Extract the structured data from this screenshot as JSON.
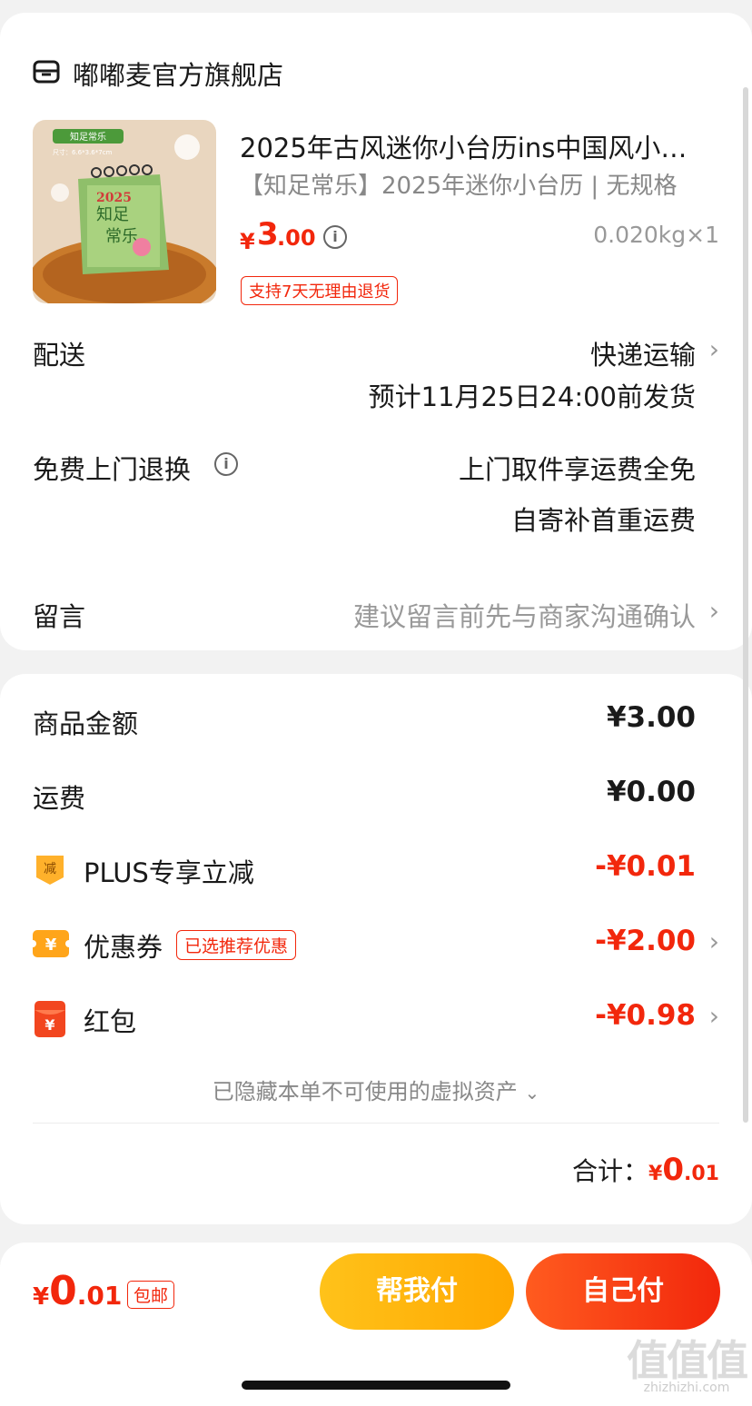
{
  "store": {
    "name": "嘟嘟麦官方旗舰店",
    "icon": "store-icon"
  },
  "product": {
    "title": "2025年古风迷你小台历ins中国风小…",
    "spec": "【知足常乐】2025年迷你小台历 | 无规格",
    "price_symbol": "¥",
    "price_int": "3",
    "price_dec": ".00",
    "weight": "0.020kg×1",
    "return_badge": "支持7天无理由退货",
    "thumb_label": "知足常乐",
    "thumb_size": "尺寸：6.6*3.6*7cm",
    "thumb_year": "2025"
  },
  "delivery": {
    "label": "配送",
    "method": "快递运输",
    "eta": "预计11月25日24:00前发货"
  },
  "exchange": {
    "label": "免费上门退换",
    "line1": "上门取件享运费全免",
    "line2": "自寄补首重运费"
  },
  "message": {
    "label": "留言",
    "placeholder": "建议留言前先与商家沟通确认"
  },
  "summary": {
    "goods_label": "商品金额",
    "goods_amount": "¥3.00",
    "freight_label": "运费",
    "freight_amount": "¥0.00",
    "plus_label": "PLUS专享立减",
    "plus_amount": "-¥0.01",
    "plus_icon_text": "减",
    "coupon_label": "优惠券",
    "coupon_tag": "已选推荐优惠",
    "coupon_amount": "-¥2.00",
    "redpack_label": "红包",
    "redpack_amount": "-¥0.98",
    "hidden_text": "已隐藏本单不可使用的虚拟资产",
    "total_label": "合计：",
    "total_symbol": "¥",
    "total_int": "0",
    "total_dec": ".01"
  },
  "bottom": {
    "price_symbol": "¥",
    "price_int": "0",
    "price_dec": ".01",
    "free_shipping": "包邮",
    "help_pay": "帮我付",
    "self_pay": "自己付"
  },
  "watermark": {
    "big": "值值值",
    "small": "zhizhizhi.com"
  },
  "colors": {
    "accent_red": "#f2270c",
    "accent_yellow": "#ffb800",
    "bg": "#f2f2f2"
  }
}
